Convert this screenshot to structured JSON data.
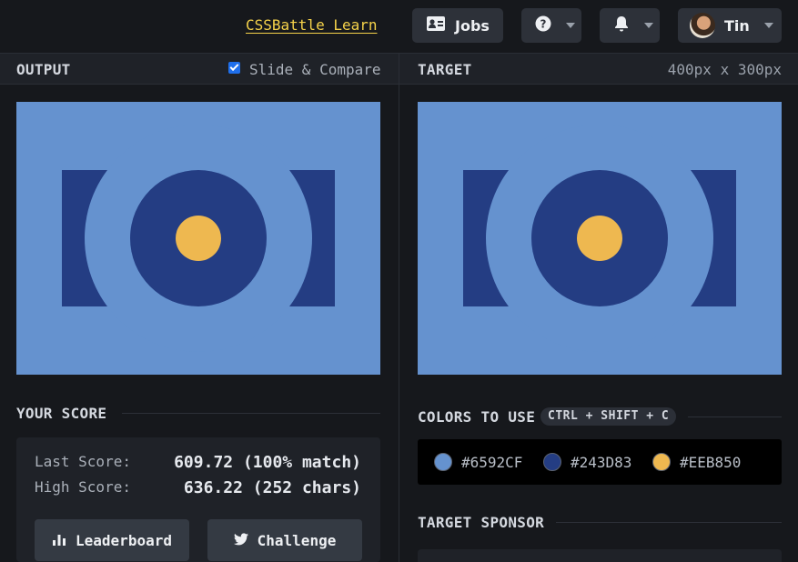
{
  "topbar": {
    "learn_link": "CSSBattle Learn",
    "jobs_label": "Jobs",
    "user_name": "Tin"
  },
  "output_panel": {
    "title": "OUTPUT",
    "compare_label": "Slide & Compare",
    "compare_checked": true
  },
  "target_panel": {
    "title": "TARGET",
    "size_label": "400px x 300px"
  },
  "score": {
    "title": "YOUR SCORE",
    "last_label": "Last Score:",
    "last_value": "609.72 (100% match)",
    "high_label": "High Score:",
    "high_value": "636.22 (252 chars)",
    "leaderboard_label": "Leaderboard",
    "challenge_label": "Challenge"
  },
  "colors": {
    "title": "COLORS TO USE",
    "shortcut": "CTRL + SHIFT + C",
    "items": [
      {
        "hex": "#6592CF"
      },
      {
        "hex": "#243D83"
      },
      {
        "hex": "#EEB850"
      }
    ]
  },
  "sponsor": {
    "title": "TARGET SPONSOR"
  },
  "icons": {
    "jobs": "id-card-icon",
    "help": "question-circle-icon",
    "notifications": "bell-icon",
    "leaderboard": "bar-chart-icon",
    "challenge": "twitter-icon"
  }
}
